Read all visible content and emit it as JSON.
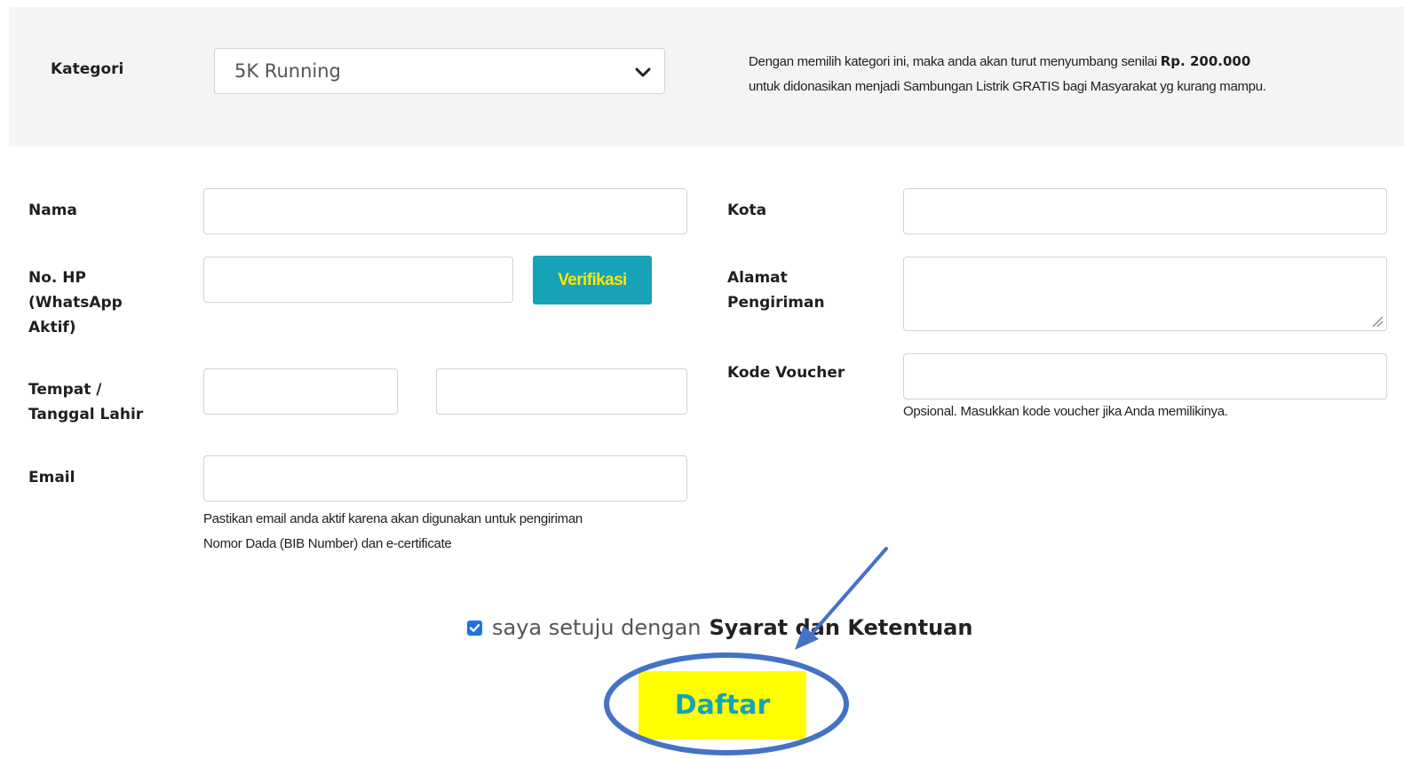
{
  "category": {
    "label": "Kategori",
    "selected": "5K Running",
    "note_prefix": "Dengan memilih kategori ini, maka anda akan turut menyumbang senilai ",
    "note_amount": "Rp. 200.000",
    "note_suffix": "untuk didonasikan menjadi Sambungan Listrik GRATIS bagi Masyarakat yg kurang mampu."
  },
  "form": {
    "nama_label": "Nama",
    "hp_label_1": "No. HP",
    "hp_label_2": "(WhatsApp",
    "hp_label_3": "Aktif)",
    "verify_button": "Verifikasi",
    "birth_label_1": "Tempat /",
    "birth_label_2": "Tanggal Lahir",
    "email_label": "Email",
    "email_help_1": "Pastikan email anda aktif karena akan digunakan untuk pengiriman",
    "email_help_2": "Nomor Dada (BIB Number) dan e-certificate",
    "kota_label": "Kota",
    "alamat_label_1": "Alamat",
    "alamat_label_2": "Pengiriman",
    "voucher_label": "Kode Voucher",
    "voucher_help": "Opsional. Masukkan kode voucher jika Anda memilikinya."
  },
  "agreement": {
    "checked": true,
    "text": "saya setuju dengan",
    "link": "Syarat dan Ketentuan"
  },
  "submit_button": "Daftar",
  "colors": {
    "panel_bg": "#f4f4f6",
    "verify_bg": "#17a2b8",
    "verify_text": "#ffe600",
    "submit_bg": "#ffff00",
    "submit_text": "#17a2b8",
    "annotation": "#4472c4"
  },
  "icons": {
    "select": "chevron-down-icon",
    "checkbox": "check-icon",
    "textarea": "resize-handle-icon"
  }
}
